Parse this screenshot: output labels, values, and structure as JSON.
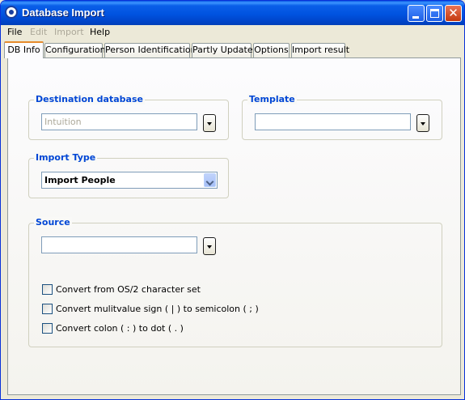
{
  "window": {
    "title": "Database Import"
  },
  "menu": {
    "file": "File",
    "edit": "Edit",
    "import": "Import",
    "help": "Help"
  },
  "tabs": [
    {
      "label": "DB Info",
      "active": true
    },
    {
      "label": "Configuration",
      "active": false
    },
    {
      "label": "Person Identification",
      "active": false
    },
    {
      "label": "Partly Update",
      "active": false
    },
    {
      "label": "Options",
      "active": false
    },
    {
      "label": "Import result",
      "active": false
    }
  ],
  "destination": {
    "label": "Destination database",
    "value": "Intuition"
  },
  "template": {
    "label": "Template",
    "value": ""
  },
  "import_type": {
    "label": "Import Type",
    "selected": "Import People"
  },
  "source": {
    "label": "Source",
    "value": "",
    "options": [
      {
        "label": "Convert from OS/2 character set",
        "checked": false
      },
      {
        "label": "Convert mulitvalue sign ( | )  to semicolon ( ; )",
        "checked": false
      },
      {
        "label": "Convert colon ( : ) to dot ( . )",
        "checked": false
      }
    ]
  }
}
